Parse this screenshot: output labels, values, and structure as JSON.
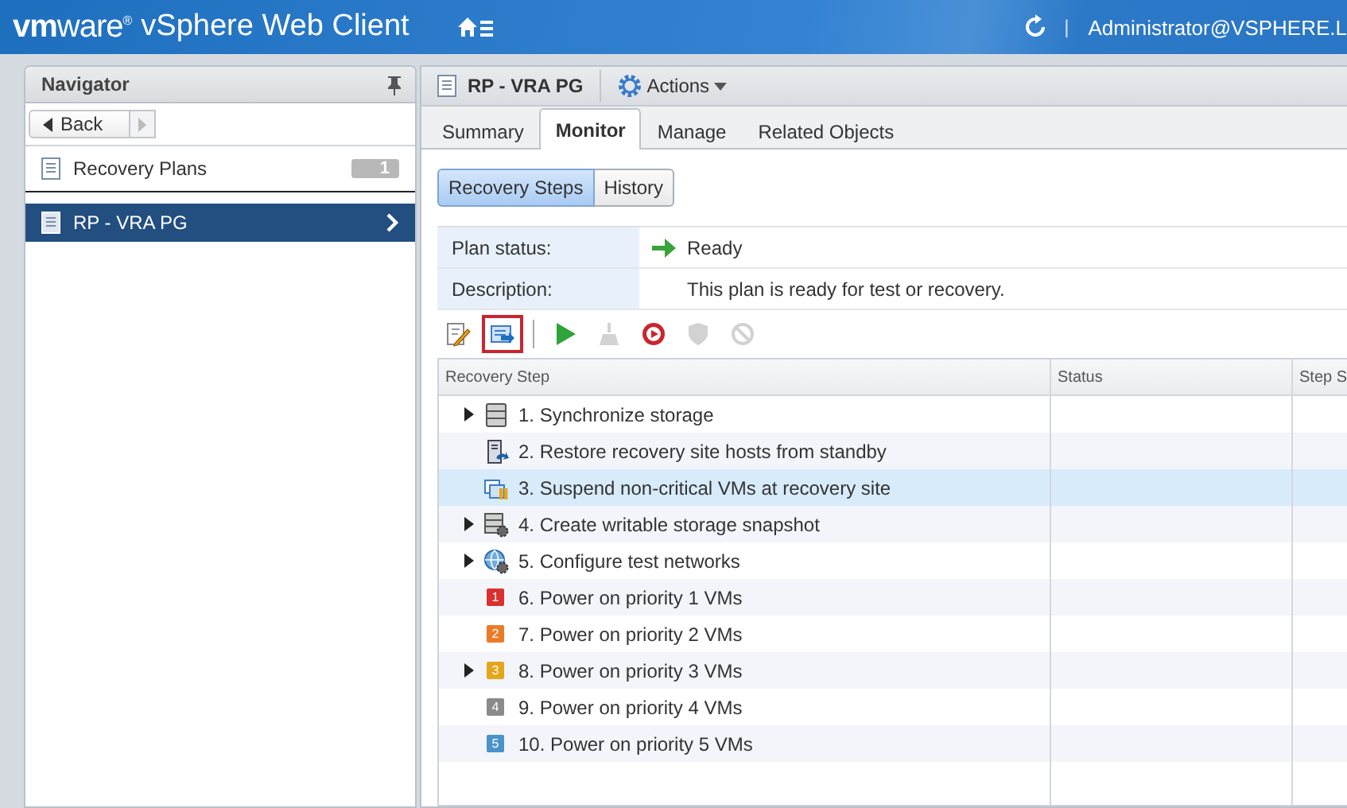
{
  "header": {
    "logo": "**vm**ware$^{®}$",
    "title": "vSphere Web Client",
    "separator": "|",
    "user": "Administrator@VSPHERE.L"
  },
  "navigator": {
    "title": "Navigator",
    "back": "Back",
    "items": [
      {
        "label": "Recovery Plans",
        "count": "1",
        "selected": false
      },
      {
        "label": "RP - VRA PG",
        "selected": true
      }
    ]
  },
  "object": {
    "title": "RP - VRA PG",
    "actions": "Actions"
  },
  "tabs": [
    {
      "label": "Summary",
      "selected": false
    },
    {
      "label": "Monitor",
      "selected": true
    },
    {
      "label": "Manage",
      "selected": false
    },
    {
      "label": "Related Objects",
      "selected": false
    }
  ],
  "subtabs": [
    {
      "label": "Recovery Steps",
      "selected": true
    },
    {
      "label": "History",
      "selected": false
    }
  ],
  "plan": [
    {
      "label": "Plan status:",
      "value": "Ready",
      "arrow": true
    },
    {
      "label": "Description:",
      "value": "This plan is ready for test or recovery.",
      "arrow": false
    }
  ],
  "tool_groups": [
    {
      "tools": [
        {
          "kind": "edit",
          "disabled": false,
          "highlighted": false
        },
        {
          "kind": "move",
          "disabled": false,
          "highlighted": true
        }
      ]
    },
    {
      "tools": [
        {
          "kind": "run",
          "disabled": false,
          "highlighted": false
        },
        {
          "kind": "cleanup",
          "disabled": true,
          "highlighted": false
        },
        {
          "kind": "record",
          "disabled": false,
          "highlighted": false
        },
        {
          "kind": "shield",
          "disabled": true,
          "highlighted": false
        },
        {
          "kind": "cancel",
          "disabled": true,
          "highlighted": false
        }
      ]
    }
  ],
  "table": {
    "columns": [
      "Recovery Step",
      "Status",
      "Step S"
    ],
    "rows": [
      {
        "step": "1. Synchronize storage",
        "kind": "storage",
        "expander": true,
        "selected": false
      },
      {
        "step": "2. Restore recovery site hosts from standby",
        "kind": "host",
        "expander": false,
        "selected": false
      },
      {
        "step": "3. Suspend non-critical VMs at recovery site",
        "kind": "suspend",
        "expander": false,
        "selected": true
      },
      {
        "step": "4. Create writable storage snapshot",
        "kind": "snapshot",
        "expander": true,
        "selected": false
      },
      {
        "step": "5. Configure test networks",
        "kind": "network",
        "expander": true,
        "selected": false
      },
      {
        "step": "6. Power on priority 1 VMs",
        "kind": "priority",
        "badge": "1",
        "color": "#d9312f",
        "expander": false,
        "selected": false
      },
      {
        "step": "7. Power on priority 2 VMs",
        "kind": "priority",
        "badge": "2",
        "color": "#ec7b27",
        "expander": false,
        "selected": false
      },
      {
        "step": "8. Power on priority 3 VMs",
        "kind": "priority",
        "badge": "3",
        "color": "#e5a61c",
        "expander": true,
        "selected": false
      },
      {
        "step": "9. Power on priority 4 VMs",
        "kind": "priority",
        "badge": "4",
        "color": "#8a8a8a",
        "expander": false,
        "selected": false
      },
      {
        "step": "10. Power on priority 5 VMs",
        "kind": "priority",
        "badge": "5",
        "color": "#4a92cc",
        "expander": false,
        "selected": false
      }
    ]
  }
}
